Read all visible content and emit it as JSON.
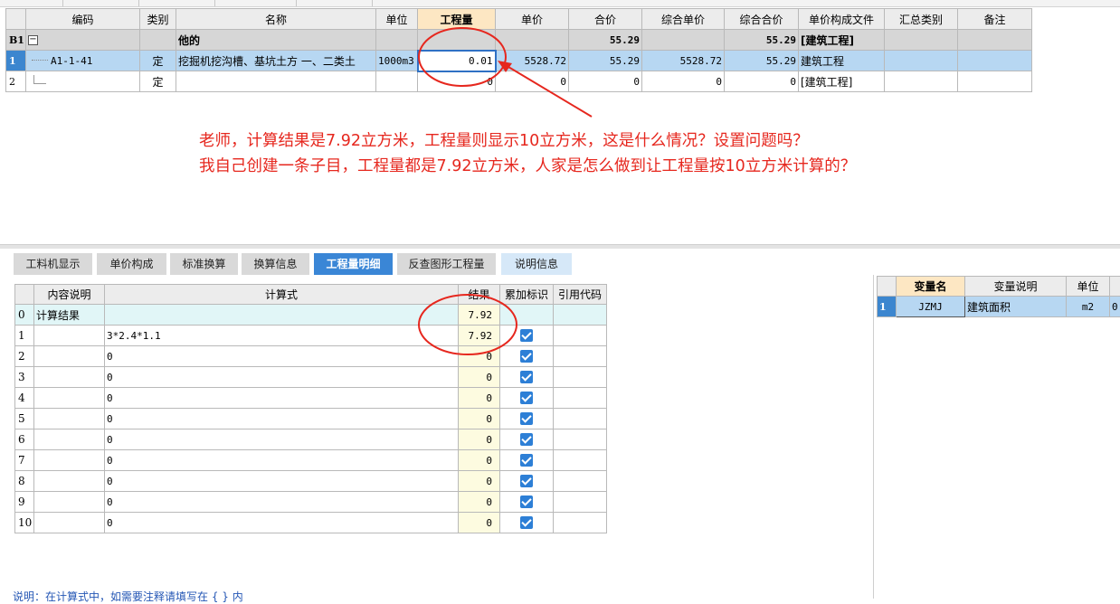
{
  "top_grid": {
    "headers": {
      "code": "编码",
      "type": "类别",
      "name": "名称",
      "unit": "单位",
      "quantity": "工程量",
      "unit_price": "单价",
      "total": "合价",
      "comp_unit_price": "综合单价",
      "comp_total": "综合合价",
      "price_file": "单价构成文件",
      "summary_type": "汇总类别",
      "remark": "备注"
    },
    "group_row": {
      "row_label": "B1",
      "collapse": "−",
      "name": "他的",
      "total": "55.29",
      "comp_total": "55.29",
      "price_file": "[建筑工程]"
    },
    "rows": [
      {
        "row_label": "1",
        "code": "A1-1-41",
        "type": "定",
        "name": "挖掘机挖沟槽、基坑土方 一、二类土",
        "unit": "1000m3",
        "quantity": "0.01",
        "unit_price": "5528.72",
        "total": "55.29",
        "comp_unit_price": "5528.72",
        "comp_total": "55.29",
        "price_file": "建筑工程"
      },
      {
        "row_label": "2",
        "code": "",
        "type": "定",
        "name": "",
        "unit": "",
        "quantity": "0",
        "unit_price": "0",
        "total": "0",
        "comp_unit_price": "0",
        "comp_total": "0",
        "price_file": "[建筑工程]"
      }
    ]
  },
  "annotation": {
    "line1": "老师，计算结果是7.92立方米，工程量则显示10立方米，这是什么情况？设置问题吗？",
    "line2": "我自己创建一条子目，工程量都是7.92立方米，人家是怎么做到让工程量按10立方米计算的？"
  },
  "tabs": [
    "工料机显示",
    "单价构成",
    "标准换算",
    "换算信息",
    "工程量明细",
    "反查图形工程量",
    "说明信息"
  ],
  "active_tab": "工程量明细",
  "calc_grid": {
    "headers": {
      "desc": "内容说明",
      "formula": "计算式",
      "result": "结果",
      "accumulate": "累加标识",
      "ref_code": "引用代码"
    },
    "rows": [
      {
        "idx": "0",
        "desc": "计算结果",
        "formula": "",
        "result": "7.92"
      },
      {
        "idx": "1",
        "desc": "",
        "formula": "3*2.4*1.1",
        "result": "7.92"
      },
      {
        "idx": "2",
        "desc": "",
        "formula": "0",
        "result": "0"
      },
      {
        "idx": "3",
        "desc": "",
        "formula": "0",
        "result": "0"
      },
      {
        "idx": "4",
        "desc": "",
        "formula": "0",
        "result": "0"
      },
      {
        "idx": "5",
        "desc": "",
        "formula": "0",
        "result": "0"
      },
      {
        "idx": "6",
        "desc": "",
        "formula": "0",
        "result": "0"
      },
      {
        "idx": "7",
        "desc": "",
        "formula": "0",
        "result": "0"
      },
      {
        "idx": "8",
        "desc": "",
        "formula": "0",
        "result": "0"
      },
      {
        "idx": "9",
        "desc": "",
        "formula": "0",
        "result": "0"
      },
      {
        "idx": "10",
        "desc": "",
        "formula": "0",
        "result": "0"
      }
    ]
  },
  "hint": "说明：在计算式中，如需要注释请填写在 { } 内",
  "var_grid": {
    "headers": {
      "name": "变量名",
      "desc": "变量说明",
      "unit": "单位"
    },
    "rows": [
      {
        "row_label": "1",
        "name": "JZMJ",
        "desc": "建筑面积",
        "unit": "m2",
        "value": "0"
      }
    ]
  },
  "colors": {
    "annotation_red": "#e6271e",
    "active_tab_blue": "#3a86d6",
    "selection_blue": "#b7d7f2",
    "highlight_header": "#fde7c3"
  }
}
